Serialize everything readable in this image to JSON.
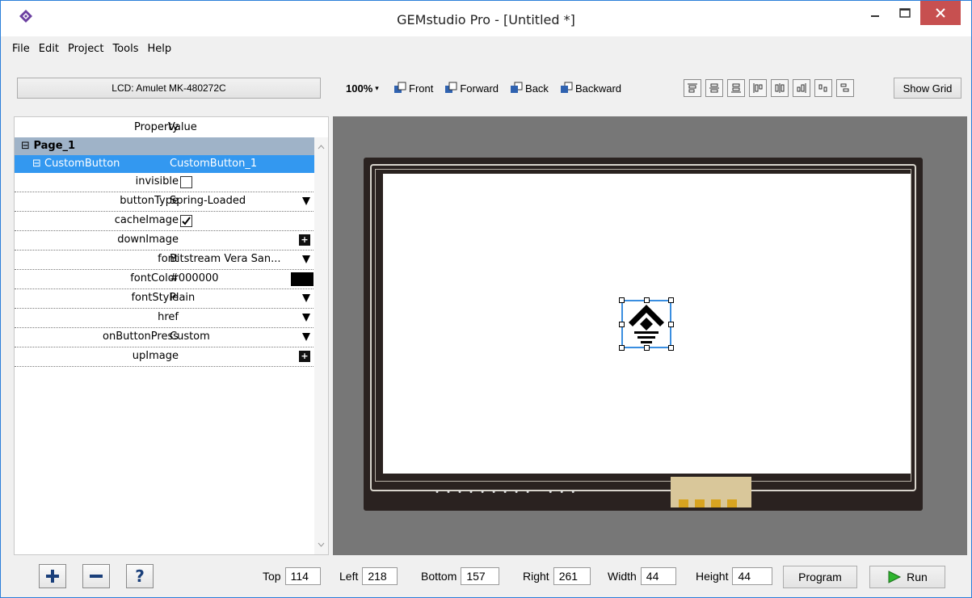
{
  "window": {
    "title": "GEMstudio Pro - [Untitled *]",
    "close_color": "#c75050"
  },
  "menu": [
    "File",
    "Edit",
    "Project",
    "Tools",
    "Help"
  ],
  "toolbar": {
    "lcd_label": "LCD: Amulet MK-480272C",
    "zoom": "100%",
    "front": "Front",
    "forward": "Forward",
    "back": "Back",
    "backward": "Backward",
    "show_grid": "Show Grid"
  },
  "properties": {
    "header_property": "Property",
    "header_value": "Value",
    "page": "Page_1",
    "widget_type": "CustomButton",
    "widget_name": "CustomButton_1",
    "rows": [
      {
        "name": "invisible",
        "value": "",
        "control": "checkbox",
        "checked": false
      },
      {
        "name": "buttonType",
        "value": "Spring-Loaded",
        "control": "dropdown"
      },
      {
        "name": "cacheImage",
        "value": "",
        "control": "checkbox",
        "checked": true
      },
      {
        "name": "downImage",
        "value": "",
        "control": "plus"
      },
      {
        "name": "font",
        "value": "Bitstream Vera San...",
        "control": "dropdown"
      },
      {
        "name": "fontColor",
        "value": "#000000",
        "control": "color",
        "color": "#000000"
      },
      {
        "name": "fontStyle",
        "value": "Plain",
        "control": "dropdown"
      },
      {
        "name": "href",
        "value": "",
        "control": "dropdown"
      },
      {
        "name": "onButtonPress",
        "value": "Custom",
        "control": "dropdown"
      },
      {
        "name": "upImage",
        "value": "",
        "control": "plus"
      }
    ]
  },
  "bottom": {
    "top_label": "Top",
    "top_value": "114",
    "left_label": "Left",
    "left_value": "218",
    "bottom_label": "Bottom",
    "bottom_value": "157",
    "right_label": "Right",
    "right_value": "261",
    "width_label": "Width",
    "width_value": "44",
    "height_label": "Height",
    "height_value": "44",
    "program": "Program",
    "run": "Run"
  },
  "icons": {
    "add": "plus-icon",
    "remove": "minus-icon",
    "help": "question-icon",
    "run": "play-icon"
  }
}
